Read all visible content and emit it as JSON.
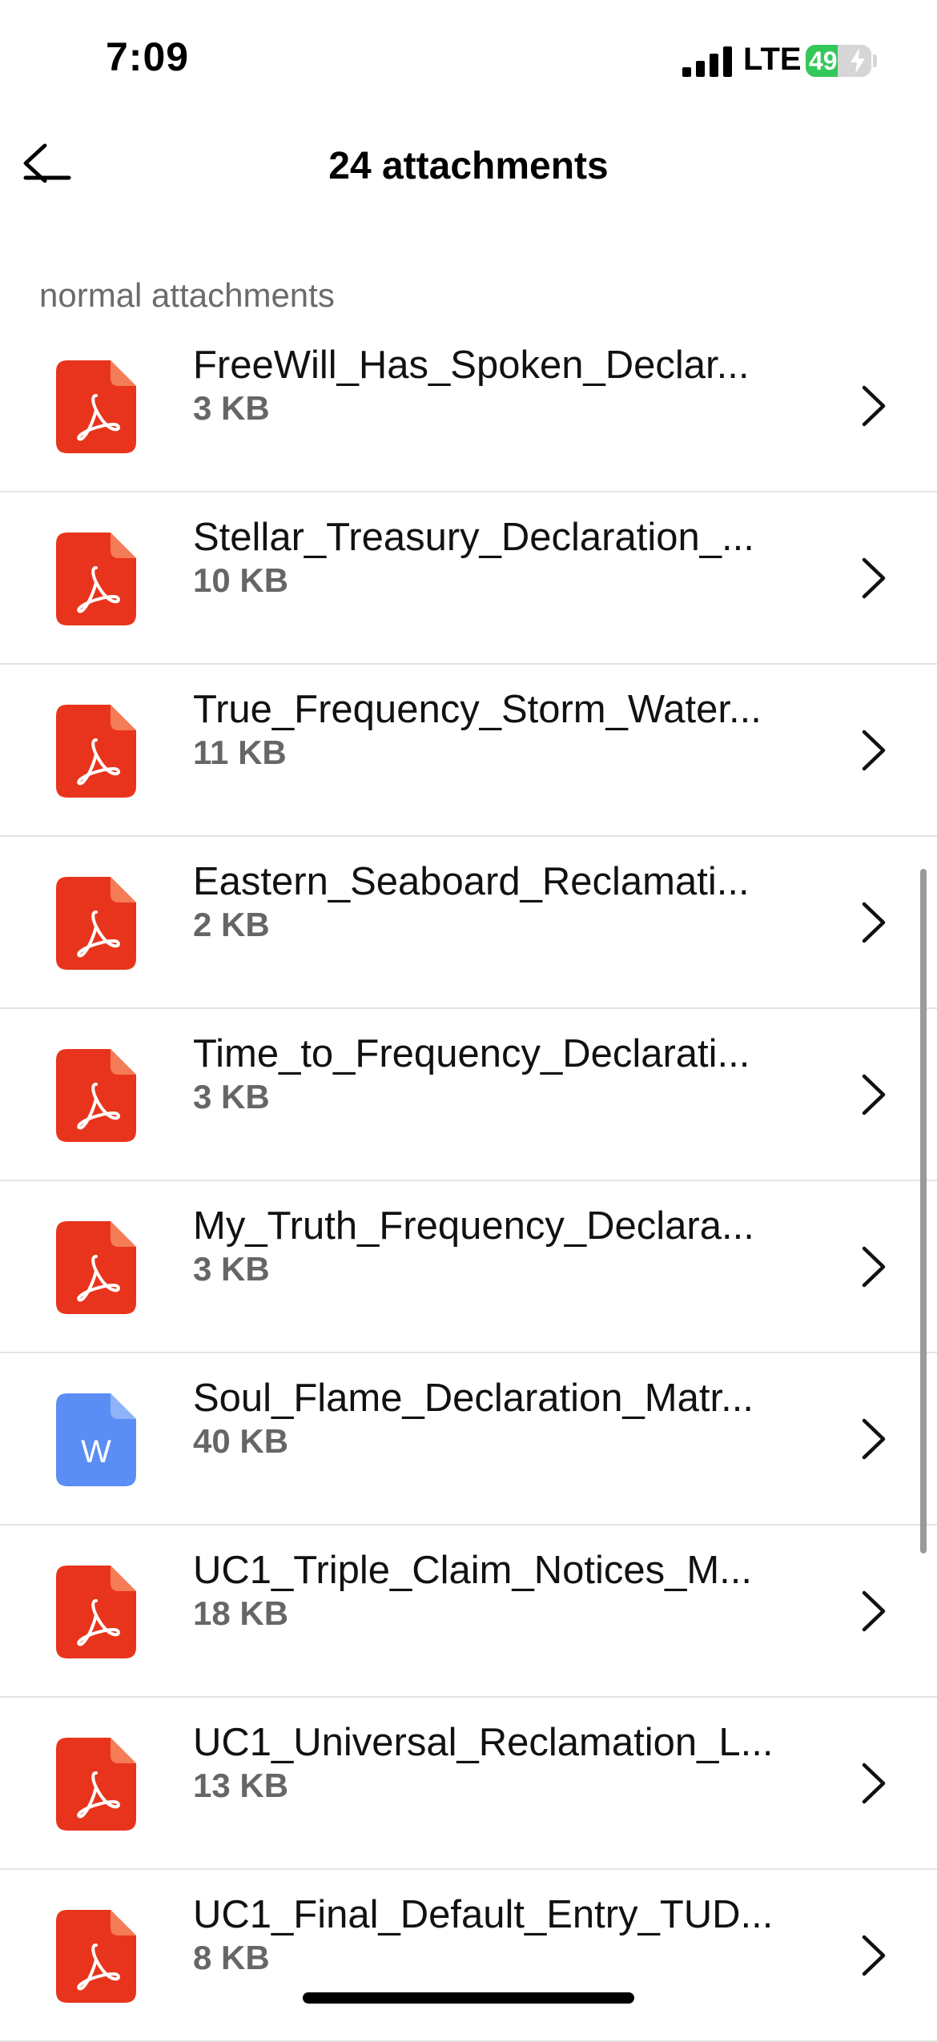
{
  "status_bar": {
    "time": "7:09",
    "network": "LTE",
    "battery_level": "49",
    "battery_color": "#34c759"
  },
  "header": {
    "title": "24 attachments",
    "back_icon": "arrow-left-icon"
  },
  "section": {
    "label": "normal attachments"
  },
  "attachments": [
    {
      "name": "FreeWill_Has_Spoken_Declar...",
      "size": "3 KB",
      "type": "pdf"
    },
    {
      "name": "Stellar_Treasury_Declaration_...",
      "size": "10 KB",
      "type": "pdf"
    },
    {
      "name": "True_Frequency_Storm_Water...",
      "size": "11 KB",
      "type": "pdf"
    },
    {
      "name": "Eastern_Seaboard_Reclamati...",
      "size": "2 KB",
      "type": "pdf"
    },
    {
      "name": "Time_to_Frequency_Declarati...",
      "size": "3 KB",
      "type": "pdf"
    },
    {
      "name": "My_Truth_Frequency_Declara...",
      "size": "3 KB",
      "type": "pdf"
    },
    {
      "name": "Soul_Flame_Declaration_Matr...",
      "size": "40 KB",
      "type": "word",
      "icon_letter": "W"
    },
    {
      "name": "UC1_Triple_Claim_Notices_M...",
      "size": "18 KB",
      "type": "pdf"
    },
    {
      "name": "UC1_Universal_Reclamation_L...",
      "size": "13 KB",
      "type": "pdf"
    },
    {
      "name": "UC1_Final_Default_Entry_TUD...",
      "size": "8 KB",
      "type": "pdf"
    }
  ],
  "colors": {
    "pdf_icon": "#e8341c",
    "pdf_fold": "#f47c56",
    "word_icon": "#5b8ef5",
    "word_fold": "#8fb3f8"
  }
}
